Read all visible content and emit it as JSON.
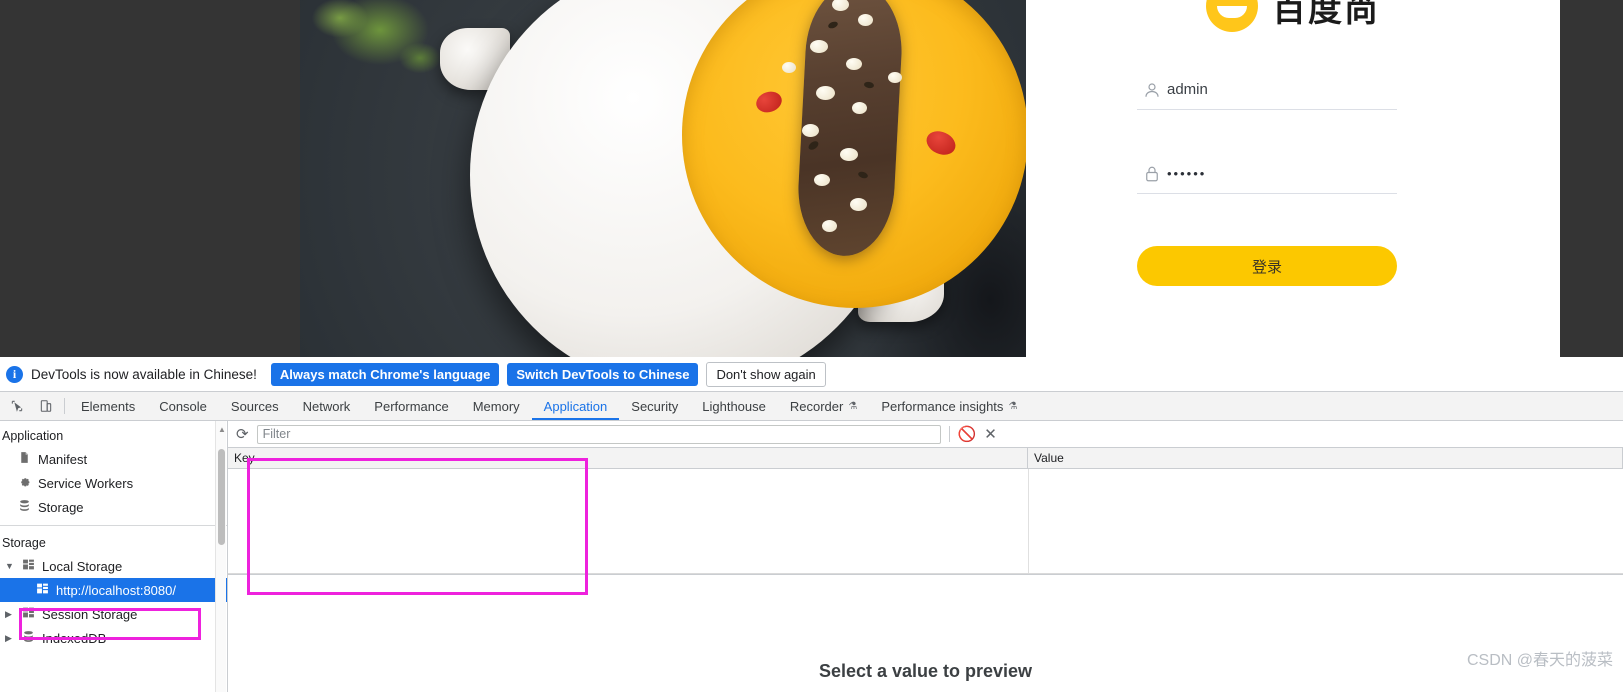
{
  "page": {
    "brand": {
      "title": "百度尚",
      "logo_color": "#ffc61a"
    },
    "login": {
      "username_icon": "user-icon",
      "username_value": "admin",
      "password_icon": "lock-icon",
      "password_value": "••••••",
      "submit_label": "登录",
      "submit_color": "#fcc800"
    }
  },
  "devtools": {
    "notice": {
      "icon": "info-icon",
      "message": "DevTools is now available in Chinese!",
      "primary_button": "Always match Chrome's language",
      "secondary_button": "Switch DevTools to Chinese",
      "dismiss_button": "Don't show again"
    },
    "toolbar_icons": [
      "inspect-element-icon",
      "device-toolbar-icon"
    ],
    "tabs": [
      {
        "label": "Elements",
        "active": false,
        "experimental": false
      },
      {
        "label": "Console",
        "active": false,
        "experimental": false
      },
      {
        "label": "Sources",
        "active": false,
        "experimental": false
      },
      {
        "label": "Network",
        "active": false,
        "experimental": false
      },
      {
        "label": "Performance",
        "active": false,
        "experimental": false
      },
      {
        "label": "Memory",
        "active": false,
        "experimental": false
      },
      {
        "label": "Application",
        "active": true,
        "experimental": false
      },
      {
        "label": "Security",
        "active": false,
        "experimental": false
      },
      {
        "label": "Lighthouse",
        "active": false,
        "experimental": false
      },
      {
        "label": "Recorder",
        "active": false,
        "experimental": true
      },
      {
        "label": "Performance insights",
        "active": false,
        "experimental": true
      }
    ],
    "sidebar": {
      "section_application": "Application",
      "application_items": [
        {
          "label": "Manifest",
          "icon": "document-icon"
        },
        {
          "label": "Service Workers",
          "icon": "gear-icon"
        },
        {
          "label": "Storage",
          "icon": "database-icon"
        }
      ],
      "section_storage": "Storage",
      "storage_items": [
        {
          "label": "Local Storage",
          "icon": "table-icon",
          "twisty": "▼",
          "selected": false,
          "child": false
        },
        {
          "label": "http://localhost:8080/",
          "icon": "table-icon",
          "twisty": "",
          "selected": true,
          "child": true
        },
        {
          "label": "Session Storage",
          "icon": "table-icon",
          "twisty": "▶",
          "selected": false,
          "child": false
        },
        {
          "label": "IndexedDB",
          "icon": "database-icon",
          "twisty": "▶",
          "selected": false,
          "child": false
        }
      ]
    },
    "filter_bar": {
      "refresh_icon": "refresh-icon",
      "filter_placeholder": "Filter",
      "filter_value": "",
      "clear_icon": "no-entry-icon",
      "delete_icon": "close-icon"
    },
    "table": {
      "columns": [
        "Key",
        "Value"
      ],
      "rows": []
    },
    "preview": {
      "empty_message": "Select a value to preview"
    }
  },
  "watermark": {
    "text": "CSDN @春天的菠菜"
  },
  "annotations": {
    "color": "#ee22dd"
  }
}
